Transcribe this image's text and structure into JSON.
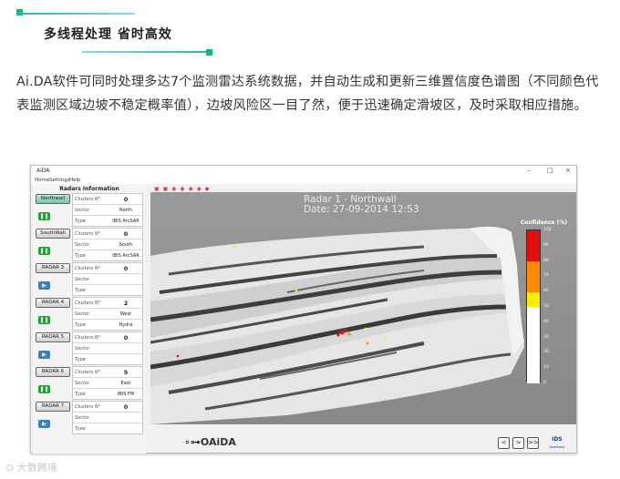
{
  "heading": "多线程处理 省时高效",
  "intro": "Ai.DA软件可同时处理多达7个监测雷达系统数据，并自动生成和更新三维置信度色谱图（不同颜色代表监测区域边坡不稳定概率值），边坡风险区一目了然，便于迅速确定滑坡区，及时采取相应措施。",
  "window": {
    "title": "AiDA",
    "menu": [
      "Home",
      "Settings",
      "Help"
    ],
    "controls": [
      "–",
      "□",
      "×"
    ]
  },
  "panel": {
    "title": "Radars Information",
    "field_labels": [
      "Clusters N°",
      "Sector",
      "Type"
    ],
    "radars": [
      {
        "name": "Northwall",
        "clusters": "0",
        "sector": "North",
        "type": "IBIS ArcSAR",
        "state": "pause",
        "state_icon": "❚❚"
      },
      {
        "name": "SouthWall",
        "clusters": "0",
        "sector": "South",
        "type": "IBIS ArcSAR",
        "state": "pause",
        "state_icon": "❚❚"
      },
      {
        "name": "RADAR 3",
        "clusters": "0",
        "sector": "",
        "type": "",
        "state": "play",
        "state_icon": "▶"
      },
      {
        "name": "RADAR 4",
        "clusters": "2",
        "sector": "West",
        "type": "Hydra",
        "state": "pause",
        "state_icon": "❚❚"
      },
      {
        "name": "RADAR 5",
        "clusters": "0",
        "sector": "",
        "type": "",
        "state": "play",
        "state_icon": "▶"
      },
      {
        "name": "RADAR 6",
        "clusters": "5",
        "sector": "East",
        "type": "IBIS FM",
        "state": "pause",
        "state_icon": "❚❚"
      },
      {
        "name": "RADAR 7",
        "clusters": "0",
        "sector": "",
        "type": "",
        "state": "play",
        "state_icon": "▶"
      }
    ]
  },
  "viewer": {
    "radar_label": "Radar 1 - Northwall",
    "date_label": "Date: 27-09-2014 12:53",
    "toolbar_icons": "▣ ▣ ◉ ◉ ◉ ◉ ◆",
    "legend_title": "Confidence (%)",
    "legend_ticks": [
      "100",
      "90",
      "80",
      "70",
      "60",
      "50",
      "40",
      "30",
      "20",
      "10",
      "0"
    ],
    "legend_colors": {
      "high": "#e01010",
      "mid_high": "#ff8c00",
      "mid": "#ffee00",
      "low": "#ffffff"
    }
  },
  "bottom": {
    "logo": "∘⊶OAiDA",
    "nav": [
      "<",
      ">",
      ">>"
    ],
    "ids_logo": "IDS",
    "ids_sub": "GeoRadar"
  },
  "watermark": "⊙ 大数跨境"
}
